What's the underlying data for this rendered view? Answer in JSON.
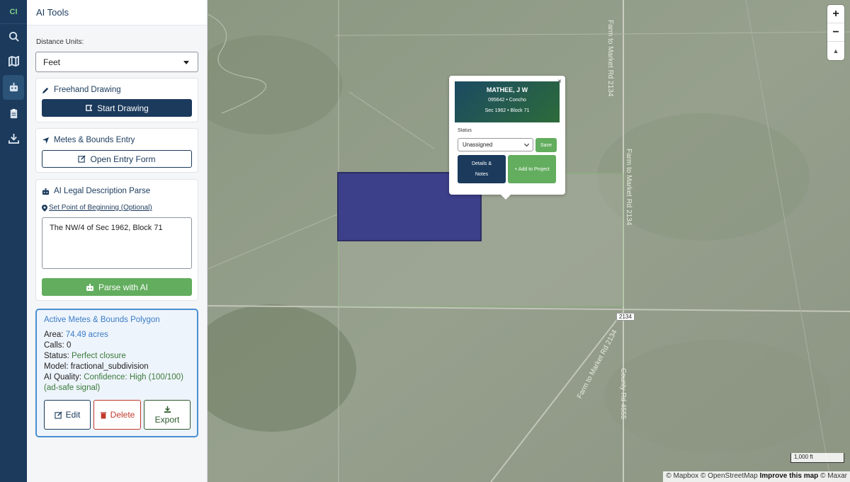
{
  "rail": {
    "logo": "CI",
    "items": [
      "search-icon",
      "map-icon",
      "robot-icon",
      "clipboard-icon",
      "download-icon"
    ]
  },
  "panel": {
    "title": "AI Tools",
    "distance_units_label": "Distance Units:",
    "distance_units_value": "Feet",
    "freehand": {
      "title": "Freehand Drawing",
      "button": "Start Drawing"
    },
    "metes": {
      "title": "Metes & Bounds Entry",
      "button": "Open Entry Form"
    },
    "ai_parse": {
      "title": "AI Legal Description Parse",
      "pob_link": "Set Point of Beginning (Optional)",
      "text": "The NW/4 of Sec 1962, Block 71",
      "button": "Parse with AI"
    },
    "active": {
      "title": "Active Metes & Bounds Polygon",
      "area_label": "Area:",
      "area_value": "74.49 acres",
      "calls_label": "Calls:",
      "calls_value": "0",
      "status_label": "Status:",
      "status_value": "Perfect closure",
      "model_label": "Model:",
      "model_value": "fractional_subdivision",
      "quality_label": "AI Quality:",
      "quality_value": "Confidence: High (100/100)",
      "signal": "(ad-safe signal)",
      "edit": "Edit",
      "delete": "Delete",
      "export": "Export"
    }
  },
  "map": {
    "road_labels": {
      "fm_top": "Farm to Market Rd 2134",
      "fm_mid": "Farm to Market Rd 2134",
      "shield": "2134",
      "fm_low": "Farm to Market Rd 2134",
      "county": "County Rd 4555"
    },
    "zoom_in": "+",
    "zoom_out": "−",
    "reset": "▲",
    "scale": "1,000 ft",
    "attribution": {
      "mapbox": "© Mapbox",
      "osm": "© OpenStreetMap",
      "improve": "Improve this map",
      "maxar": "© Maxar"
    },
    "popup": {
      "name": "MATHEE, J W",
      "line1": "095642 • Concho",
      "line2": "Sec 1962 • Block 71",
      "close": "×",
      "status_label": "Status",
      "status_value": "Unassigned",
      "save": "Save",
      "details": "Details & Notes",
      "add": "+ Add to Project"
    }
  },
  "colors": {
    "navy": "#1b3a5c",
    "green": "#62ad5e",
    "accent_blue": "#3a7cc7",
    "danger": "#c0392b",
    "polygon": "#2c2e88"
  }
}
